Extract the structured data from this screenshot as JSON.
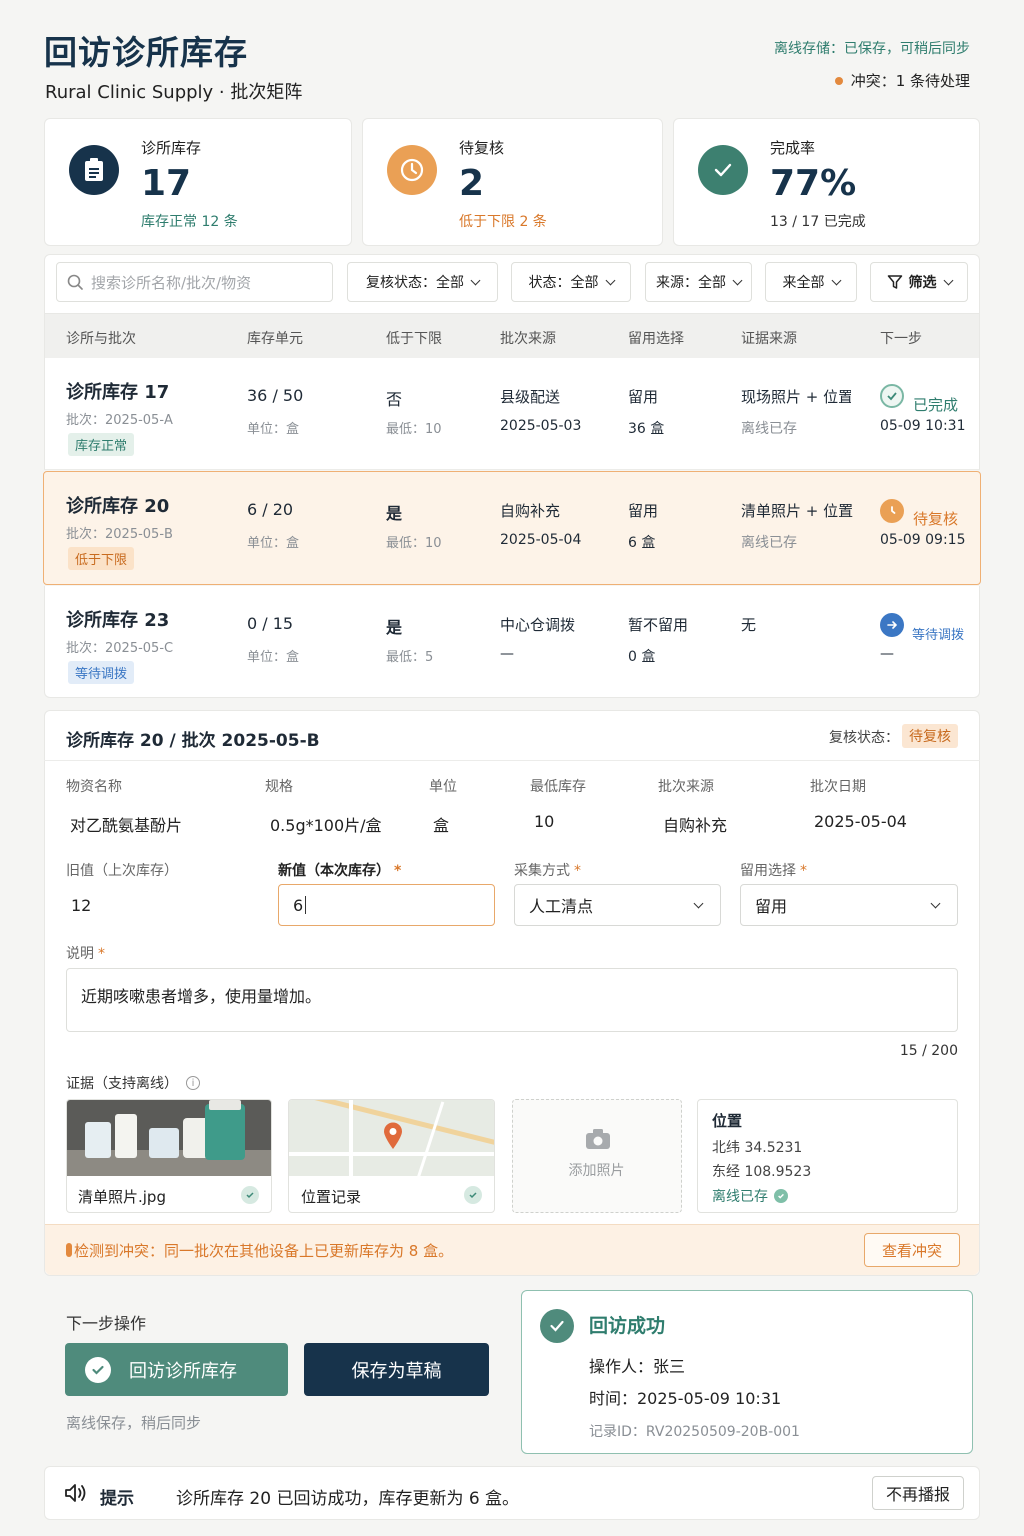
{
  "header": {
    "title": "回访诊所库存",
    "subtitle": "Rural Clinic Supply · 批次矩阵",
    "offline_status": "离线存储：已保存，可稍后同步",
    "conflict_status": "冲突：1 条待处理"
  },
  "stats": [
    {
      "label": "诊所库存",
      "value": "17",
      "sub": "库存正常 12 条",
      "icon": "clipboard-icon"
    },
    {
      "label": "待复核",
      "value": "2",
      "sub": "低于下限 2 条",
      "icon": "clock-icon"
    },
    {
      "label": "完成率",
      "value": "77%",
      "sub": "13 / 17 已完成",
      "icon": "check-icon"
    }
  ],
  "filters": {
    "search_placeholder": "搜索诊所名称/批次/物资",
    "review_status": "复核状态：全部",
    "status": "状态：全部",
    "source": "来源：全部",
    "come_all": "来全部",
    "filter": "筛选"
  },
  "table": {
    "headers": [
      "诊所与批次",
      "库存单元",
      "低于下限",
      "批次来源",
      "留用选择",
      "证据来源",
      "下一步"
    ],
    "rows": [
      {
        "name": "诊所库存 17",
        "batch": "批次：2025-05-A",
        "tag": "库存正常",
        "qty": "36 / 50",
        "unit": "单位：盒",
        "below": "否",
        "min": "最低：10",
        "source": "县级配送",
        "date": "2025-05-03",
        "keep": "留用",
        "keep_qty": "36 盒",
        "evidence": "现场照片 + 位置",
        "evidence_sub": "离线已存",
        "next": "已完成",
        "next_time": "05-09 10:31"
      },
      {
        "name": "诊所库存 20",
        "batch": "批次：2025-05-B",
        "tag": "低于下限",
        "qty": "6 / 20",
        "unit": "单位：盒",
        "below": "是",
        "min": "最低：10",
        "source": "自购补充",
        "date": "2025-05-04",
        "keep": "留用",
        "keep_qty": "6 盒",
        "evidence": "清单照片 + 位置",
        "evidence_sub": "离线已存",
        "next": "待复核",
        "next_time": "05-09 09:15"
      },
      {
        "name": "诊所库存 23",
        "batch": "批次：2025-05-C",
        "tag": "等待调拨",
        "qty": "0 / 15",
        "unit": "单位：盒",
        "below": "是",
        "min": "最低：5",
        "source": "中心仓调拨",
        "date": "—",
        "keep": "暂不留用",
        "keep_qty": "0 盒",
        "evidence": "无",
        "evidence_sub": "",
        "next": "等待调拨",
        "next_time": "—"
      }
    ]
  },
  "detail": {
    "title": "诊所库存 20 / 批次 2025-05-B",
    "review_label": "复核状态：",
    "review_value": "待复核",
    "fields": [
      {
        "label": "物资名称",
        "value": "对乙酰氨基酚片"
      },
      {
        "label": "规格",
        "value": "0.5g*100片/盒"
      },
      {
        "label": "单位",
        "value": "盒"
      },
      {
        "label": "最低库存",
        "value": "10"
      },
      {
        "label": "批次来源",
        "value": "自购补充"
      },
      {
        "label": "批次日期",
        "value": "2025-05-04"
      }
    ],
    "old_label": "旧值（上次库存）",
    "old_value": "12",
    "new_label": "新值（本次库存）",
    "new_value": "6",
    "method_label": "采集方式",
    "method_value": "人工清点",
    "keep_label": "留用选择",
    "keep_value": "留用",
    "note_label": "说明",
    "note_value": "近期咳嗽患者增多，使用量增加。",
    "note_count": "15 / 200",
    "evidence_label": "证据（支持离线）",
    "photo1_name": "清单照片.jpg",
    "photo2_name": "位置记录",
    "add_photo": "添加照片",
    "location_title": "位置",
    "lat": "北纬 34.5231",
    "lng": "东经 108.9523",
    "loc_status": "离线已存",
    "conflict_text": "检测到冲突：同一批次在其他设备上已更新库存为 8 盒。",
    "conflict_button": "查看冲突"
  },
  "actions": {
    "label": "下一步操作",
    "primary": "回访诊所库存",
    "secondary": "保存为草稿",
    "hint": "离线保存，稍后同步"
  },
  "success": {
    "title": "回访成功",
    "operator": "操作人：张三",
    "time": "时间：2025-05-09 10:31",
    "record": "记录ID：RV20250509-20B-001"
  },
  "tip": {
    "label": "提示",
    "text": "诊所库存 20 已回访成功，库存更新为 6 盒。",
    "button": "不再播报"
  },
  "colors": {
    "teal": "#2f7d6e",
    "orange": "#d9782a",
    "navy": "#17334b",
    "blue": "#3b77c4"
  }
}
